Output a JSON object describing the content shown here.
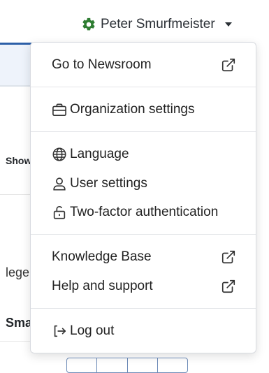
{
  "header": {
    "user_name": "Peter Smurfmeister",
    "accent_color": "#2e7d32"
  },
  "background": {
    "show_text": "Show",
    "lege_text": "lege",
    "sma_text": "Sma"
  },
  "menu": {
    "go_to_newsroom": "Go to Newsroom",
    "organization_settings": "Organization settings",
    "language": "Language",
    "user_settings": "User settings",
    "two_factor": "Two-factor authentication",
    "knowledge_base": "Knowledge Base",
    "help_and_support": "Help and support",
    "log_out": "Log out"
  }
}
